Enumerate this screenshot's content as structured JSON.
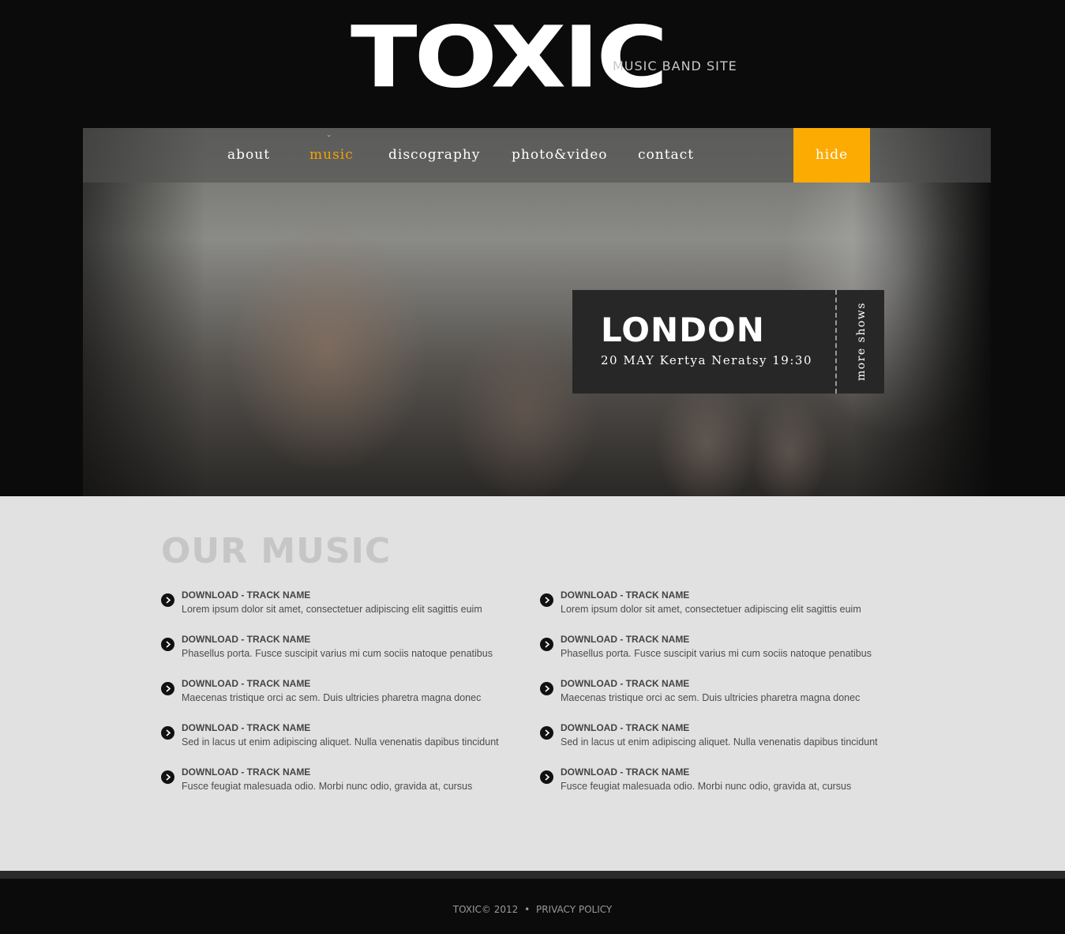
{
  "brand": {
    "name": "TOXIC",
    "tagline": "MUSIC BAND SITE"
  },
  "nav": {
    "items": [
      {
        "label": "about"
      },
      {
        "label": "music"
      },
      {
        "label": "discography"
      },
      {
        "label": "photo&video"
      },
      {
        "label": "contact"
      }
    ],
    "active": "music",
    "hide_label": "hide"
  },
  "show": {
    "city": "LONDON",
    "details": "20 MAY Kertya Neratsy 19:30",
    "more_label": "more shows"
  },
  "music": {
    "title": "OUR MUSIC",
    "left": [
      {
        "name": "DOWNLOAD - TRACK NAME",
        "desc": "Lorem ipsum dolor sit amet, consectetuer adipiscing elit sagittis euim"
      },
      {
        "name": "DOWNLOAD - TRACK NAME",
        "desc": "Phasellus porta. Fusce suscipit varius mi cum sociis natoque penatibus"
      },
      {
        "name": "DOWNLOAD - TRACK NAME",
        "desc": "Maecenas tristique orci ac sem. Duis ultricies pharetra magna donec"
      },
      {
        "name": "DOWNLOAD - TRACK NAME",
        "desc": "Sed in lacus ut enim adipiscing aliquet. Nulla venenatis dapibus tincidunt"
      },
      {
        "name": "DOWNLOAD - TRACK NAME",
        "desc": "Fusce feugiat malesuada odio. Morbi nunc odio, gravida at, cursus"
      }
    ],
    "right": [
      {
        "name": "DOWNLOAD - TRACK NAME",
        "desc": "Lorem ipsum dolor sit amet, consectetuer adipiscing elit sagittis euim"
      },
      {
        "name": "DOWNLOAD - TRACK NAME",
        "desc": "Phasellus porta. Fusce suscipit varius mi cum sociis natoque penatibus"
      },
      {
        "name": "DOWNLOAD - TRACK NAME",
        "desc": "Maecenas tristique orci ac sem. Duis ultricies pharetra magna donec"
      },
      {
        "name": "DOWNLOAD - TRACK NAME",
        "desc": "Sed in lacus ut enim adipiscing aliquet. Nulla venenatis dapibus tincidunt"
      },
      {
        "name": "DOWNLOAD - TRACK NAME",
        "desc": "Fusce feugiat malesuada odio. Morbi nunc odio, gravida at, cursus"
      }
    ]
  },
  "footer": {
    "copyright": "TOXIC© 2012",
    "separator": "•",
    "privacy": "PRIVACY POLICY"
  },
  "colors": {
    "accent": "#fcab03",
    "active_nav": "#f5a300",
    "background": "#0b0b0b",
    "content_bg": "#e1e1e1"
  }
}
